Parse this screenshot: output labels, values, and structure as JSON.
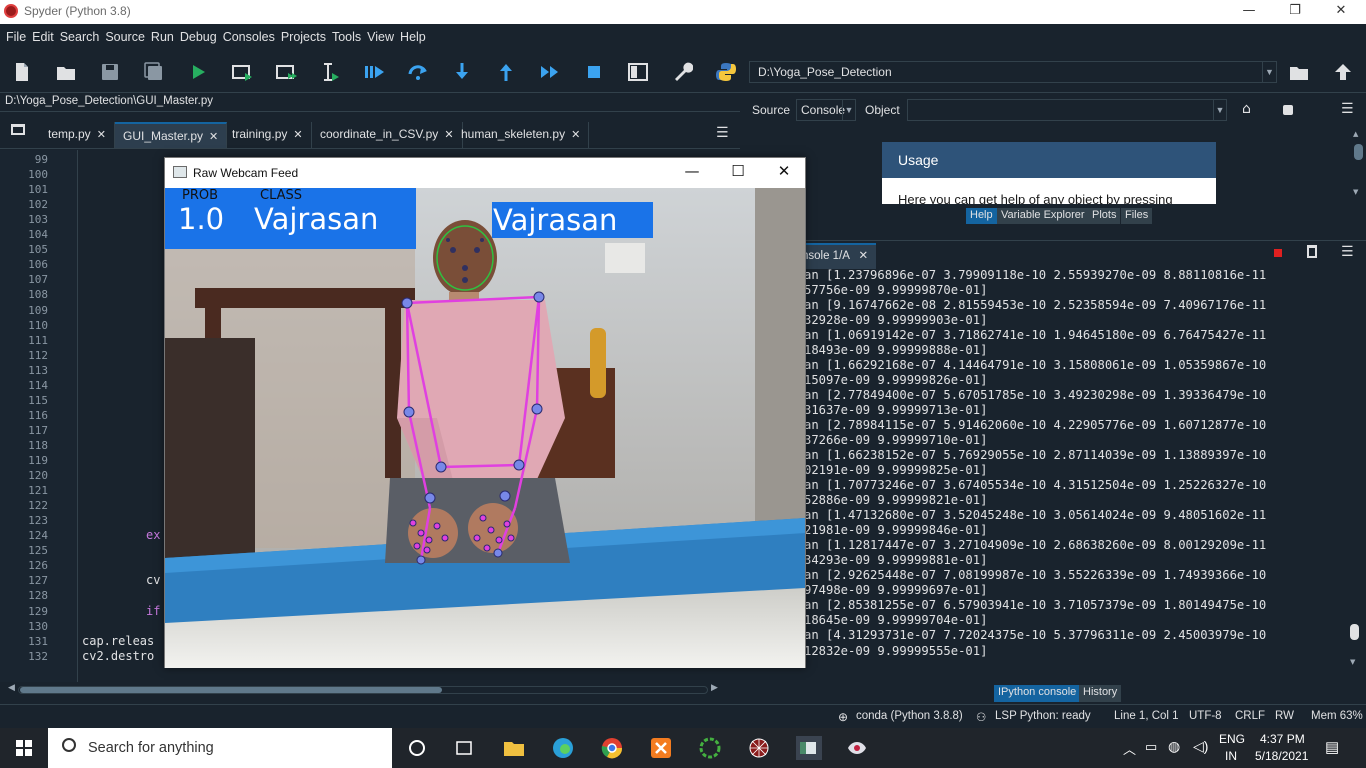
{
  "window": {
    "title": "Spyder (Python 3.8)",
    "minimize": "—",
    "maximize": "❐",
    "close": "✕"
  },
  "menu": [
    "File",
    "Edit",
    "Search",
    "Source",
    "Run",
    "Debug",
    "Consoles",
    "Projects",
    "Tools",
    "View",
    "Help"
  ],
  "toolbar": {
    "working_dir": "D:\\Yoga_Pose_Detection"
  },
  "editor": {
    "path": "D:\\Yoga_Pose_Detection\\GUI_Master.py",
    "tabs": [
      {
        "label": "temp.py",
        "close": "✕"
      },
      {
        "label": "GUI_Master.py",
        "close": "✕",
        "active": true
      },
      {
        "label": "training.py",
        "close": "✕"
      },
      {
        "label": "coordinate_in_CSV.py",
        "close": "✕"
      },
      {
        "label": "human_skeleten.py",
        "close": "✕"
      }
    ],
    "line_numbers": [
      "99",
      "100",
      "101",
      "102",
      "103",
      "104",
      "105",
      "106",
      "107",
      "108",
      "109",
      "110",
      "111",
      "112",
      "113",
      "114",
      "115",
      "116",
      "117",
      "118",
      "119",
      "120",
      "121",
      "122",
      "123",
      "124",
      "125",
      "126",
      "127",
      "128",
      "129",
      "130",
      "131",
      "132"
    ],
    "visible_code": [
      {
        "line": "124",
        "text": "ex"
      },
      {
        "line": "127",
        "text": "cv"
      },
      {
        "line": "129",
        "text": "if"
      },
      {
        "line": "131",
        "text": "cap.releas"
      },
      {
        "line": "132",
        "text": "cv2.destro"
      }
    ]
  },
  "help": {
    "source_label": "Source",
    "source_value": "Console",
    "object_label": "Object",
    "usage_title": "Usage",
    "usage_text": "Here you can get help of any object by pressing",
    "tabs": [
      "Help",
      "Variable Explorer",
      "Plots",
      "Files"
    ]
  },
  "console": {
    "tab_label": "nsole 1/A",
    "tab_close": "✕",
    "lines": [
      "an [1.23796896e-07 3.79909118e-10 2.55939270e-09 8.88110816e-11",
      "57756e-09 9.99999870e-01]",
      "an [9.16747662e-08 2.81559453e-10 2.52358594e-09 7.40967176e-11",
      "32928e-09 9.99999903e-01]",
      "an [1.06919142e-07 3.71862741e-10 1.94645180e-09 6.76475427e-11",
      "18493e-09 9.99999888e-01]",
      "an [1.66292168e-07 4.14464791e-10 3.15808061e-09 1.05359867e-10",
      "15097e-09 9.99999826e-01]",
      "an [2.77849400e-07 5.67051785e-10 3.49230298e-09 1.39336479e-10",
      "31637e-09 9.99999713e-01]",
      "an [2.78984115e-07 5.91462060e-10 4.22905776e-09 1.60712877e-10",
      "37266e-09 9.99999710e-01]",
      "an [1.66238152e-07 5.76929055e-10 2.87114039e-09 1.13889397e-10",
      "02191e-09 9.99999825e-01]",
      "an [1.70773246e-07 3.67405534e-10 4.31512504e-09 1.25226327e-10",
      "52886e-09 9.99999821e-01]",
      "an [1.47132680e-07 3.52045248e-10 3.05614024e-09 9.48051602e-11",
      "21981e-09 9.99999846e-01]",
      "an [1.12817447e-07 3.27104909e-10 2.68638260e-09 8.00129209e-11",
      "34293e-09 9.99999881e-01]",
      "an [2.92625448e-07 7.08199987e-10 3.55226339e-09 1.74939366e-10",
      "97498e-09 9.99999697e-01]",
      "an [2.85381255e-07 6.57903941e-10 3.71057379e-09 1.80149475e-10",
      "18645e-09 9.99999704e-01]",
      "an [4.31293731e-07 7.72024375e-10 5.37796311e-09 2.45003979e-10",
      "12832e-09 9.99999555e-01]"
    ],
    "bottom_tabs": [
      "IPython console",
      "History"
    ]
  },
  "statusbar": {
    "conda": "conda (Python 3.8.8)",
    "lsp": "LSP Python: ready",
    "position": "Line 1, Col 1",
    "encoding": "UTF-8",
    "eol": "CRLF",
    "rw": "RW",
    "mem": "Mem 63%"
  },
  "webcam": {
    "title": "Raw Webcam Feed",
    "minimize": "—",
    "maximize": "☐",
    "close": "✕",
    "prob_label": "PROB",
    "class_label": "CLASS",
    "prob_value": "1.0",
    "class_value": "Vajrasan",
    "overlay_label": "Vajrasan"
  },
  "taskbar": {
    "search_placeholder": "Search for anything",
    "language": "ENG",
    "region": "IN",
    "time": "4:37 PM",
    "date": "5/18/2021"
  },
  "colors": {
    "bg": "#19232d",
    "accent": "#1464a0",
    "overlay_blue": "#1a73e8",
    "skeleton": "#e040e0"
  }
}
